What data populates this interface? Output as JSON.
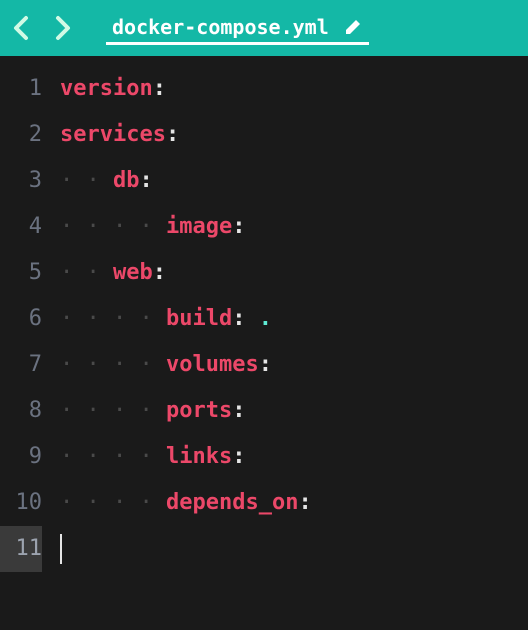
{
  "tab": {
    "filename": "docker-compose.yml"
  },
  "editor": {
    "lines": [
      {
        "num": "1",
        "indent": 0,
        "key": "version",
        "value": ""
      },
      {
        "num": "2",
        "indent": 0,
        "key": "services",
        "value": ""
      },
      {
        "num": "3",
        "indent": 1,
        "key": "db",
        "value": ""
      },
      {
        "num": "4",
        "indent": 2,
        "key": "image",
        "value": ""
      },
      {
        "num": "5",
        "indent": 1,
        "key": "web",
        "value": ""
      },
      {
        "num": "6",
        "indent": 2,
        "key": "build",
        "value": "."
      },
      {
        "num": "7",
        "indent": 2,
        "key": "volumes",
        "value": ""
      },
      {
        "num": "8",
        "indent": 2,
        "key": "ports",
        "value": ""
      },
      {
        "num": "9",
        "indent": 2,
        "key": "links",
        "value": ""
      },
      {
        "num": "10",
        "indent": 2,
        "key": "depends_on",
        "value": ""
      },
      {
        "num": "11",
        "indent": 0,
        "key": "",
        "value": "",
        "cursor": true
      }
    ]
  },
  "colors": {
    "tabbar": "#14b8a6",
    "bg": "#1a1a1a",
    "key": "#ec4869",
    "value": "#5eead4"
  }
}
